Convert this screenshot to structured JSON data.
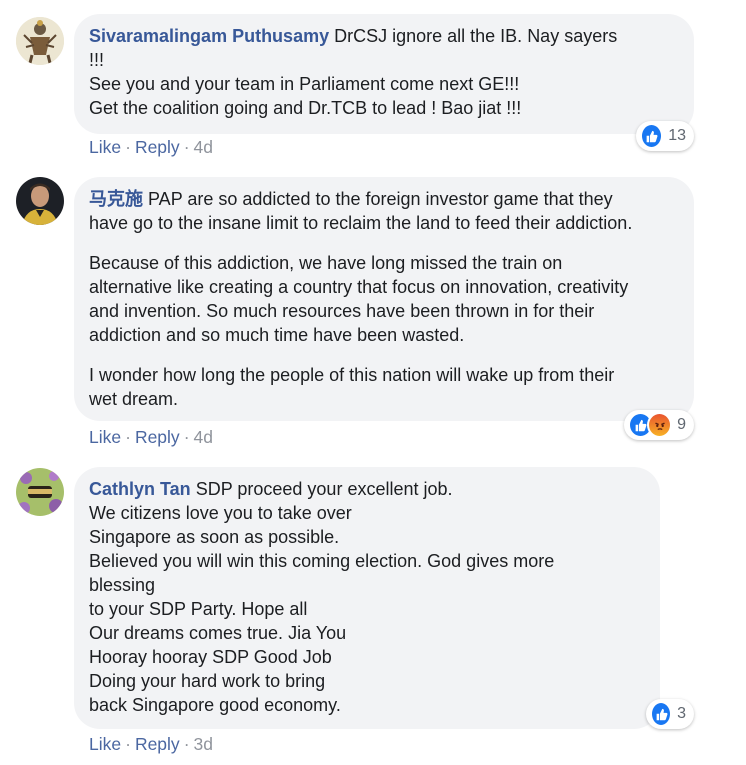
{
  "comments": [
    {
      "author": "Sivaramalingam Puthusamy",
      "paragraphs": [
        "DrCSJ ignore all the IB. Nay sayers\n!!!\nSee you and your team in Parliament come next GE!!!\nGet the coalition going and Dr.TCB to lead ! Bao jiat !!!"
      ],
      "actions": {
        "like": "Like",
        "reply": "Reply",
        "time": "4d"
      },
      "reactions": {
        "count": "13",
        "types": [
          "like"
        ]
      }
    },
    {
      "author": "马克施",
      "paragraphs": [
        "PAP are so addicted to the foreign investor game that they\nhave go to the insane limit to reclaim the land to feed their addiction.",
        "Because of this addiction, we have long missed the train on\nalternative like creating a country that focus on innovation, creativity\nand invention. So much resources have been thrown in for their\naddiction and so much time have been wasted.",
        "I wonder how long the people of this nation will wake up from their\nwet dream."
      ],
      "actions": {
        "like": "Like",
        "reply": "Reply",
        "time": "4d"
      },
      "reactions": {
        "count": "9",
        "types": [
          "like",
          "angry"
        ]
      }
    },
    {
      "author": "Cathlyn Tan",
      "paragraphs": [
        "SDP proceed your excellent job.\nWe citizens love you to take over\nSingapore as soon as possible.\nBelieved you will win this coming election. God gives more\nblessing\nto your SDP Party. Hope all\nOur dreams comes true. Jia You\nHooray hooray SDP Good Job\nDoing your hard work to bring\nback Singapore good economy."
      ],
      "actions": {
        "like": "Like",
        "reply": "Reply",
        "time": "3d"
      },
      "reactions": {
        "count": "3",
        "types": [
          "like"
        ]
      }
    }
  ],
  "colors": {
    "author_link": "#385898",
    "action_link": "#4b67a1",
    "bubble_bg": "#f2f3f5",
    "like_blue": "#1877f2"
  }
}
